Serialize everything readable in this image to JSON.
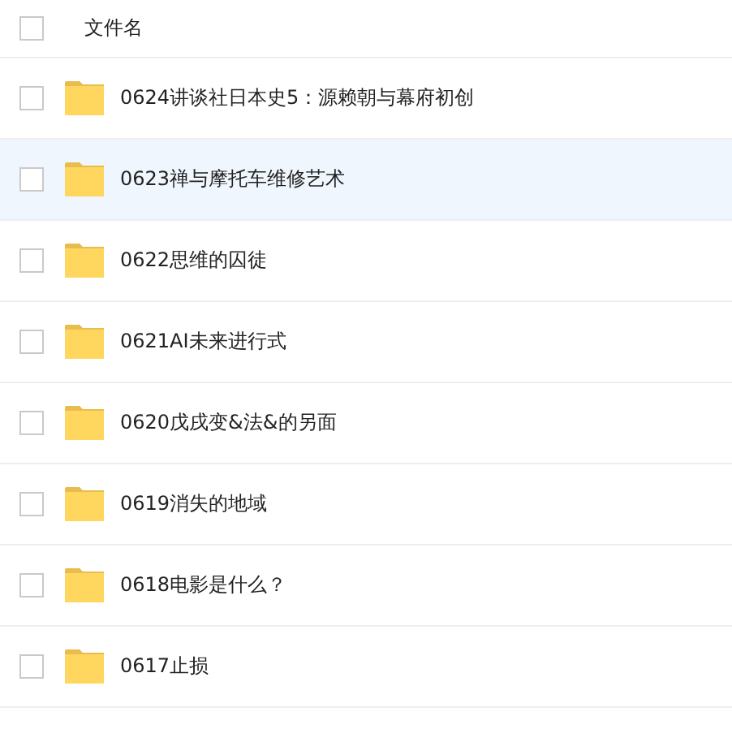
{
  "header": {
    "label": "文件名",
    "checked": false
  },
  "files": [
    {
      "name": "0624讲谈社日本史5：源赖朝与幕府初创",
      "checked": false,
      "highlighted": false
    },
    {
      "name": "0623禅与摩托车维修艺术",
      "checked": false,
      "highlighted": true
    },
    {
      "name": "0622思维的囚徒",
      "checked": false,
      "highlighted": false
    },
    {
      "name": "0621AI未来进行式",
      "checked": false,
      "highlighted": false
    },
    {
      "name": "0620戊戌变&法&的另面",
      "checked": false,
      "highlighted": false
    },
    {
      "name": "0619消失的地域",
      "checked": false,
      "highlighted": false
    },
    {
      "name": "0618电影是什么？",
      "checked": false,
      "highlighted": false
    },
    {
      "name": "0617止损",
      "checked": false,
      "highlighted": false
    }
  ]
}
